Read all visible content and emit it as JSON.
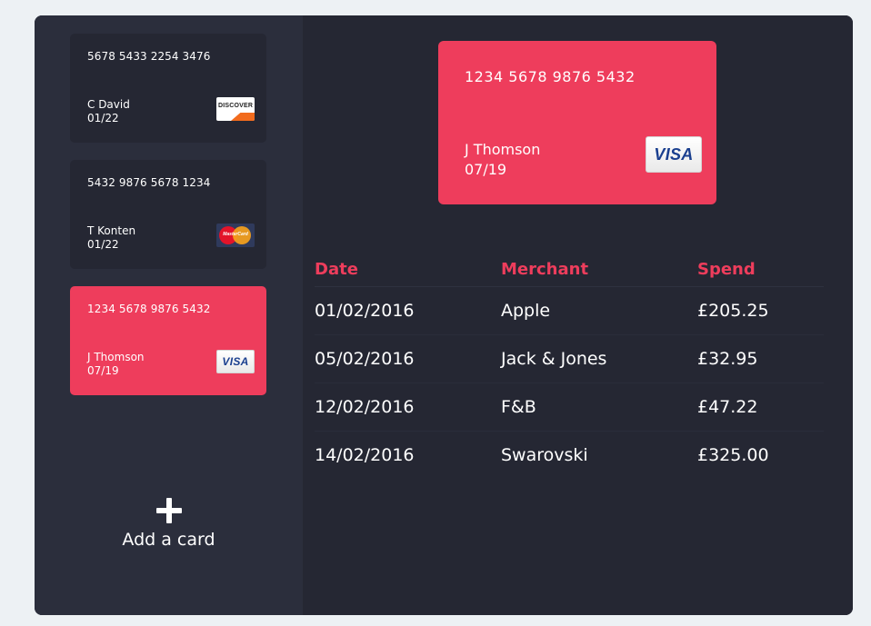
{
  "cards": [
    {
      "number": "5678 5433 2254 3476",
      "holder": "C David",
      "expiry": "01/22",
      "network": "Discover",
      "network_label": "DISCOVER"
    },
    {
      "number": "5432 9876 5678 1234",
      "holder": "T Konten",
      "expiry": "01/22",
      "network": "Mastercard",
      "network_label": "MasterCard"
    },
    {
      "number": "1234 5678 9876 5432",
      "holder": "J Thomson",
      "expiry": "07/19",
      "network": "Visa",
      "network_label": "VISA",
      "selected": true
    }
  ],
  "add_card": {
    "label": "Add a card",
    "icon": "plus-icon"
  },
  "selected_card": {
    "number": "1234 5678 9876 5432",
    "holder": "J Thomson",
    "expiry": "07/19",
    "network_label": "VISA"
  },
  "transactions": {
    "headers": [
      "Date",
      "Merchant",
      "Spend"
    ],
    "rows": [
      {
        "date": "01/02/2016",
        "merchant": "Apple",
        "spend": "£205.25"
      },
      {
        "date": "05/02/2016",
        "merchant": "Jack & Jones",
        "spend": "£32.95"
      },
      {
        "date": "12/02/2016",
        "merchant": "F&B",
        "spend": "£47.22"
      },
      {
        "date": "14/02/2016",
        "merchant": "Swarovski",
        "spend": "£325.00"
      }
    ]
  },
  "colors": {
    "accent": "#ee3d5c",
    "panel": "#252733",
    "sidebar": "#2b2e3c",
    "page_background": "#edf1f4"
  }
}
